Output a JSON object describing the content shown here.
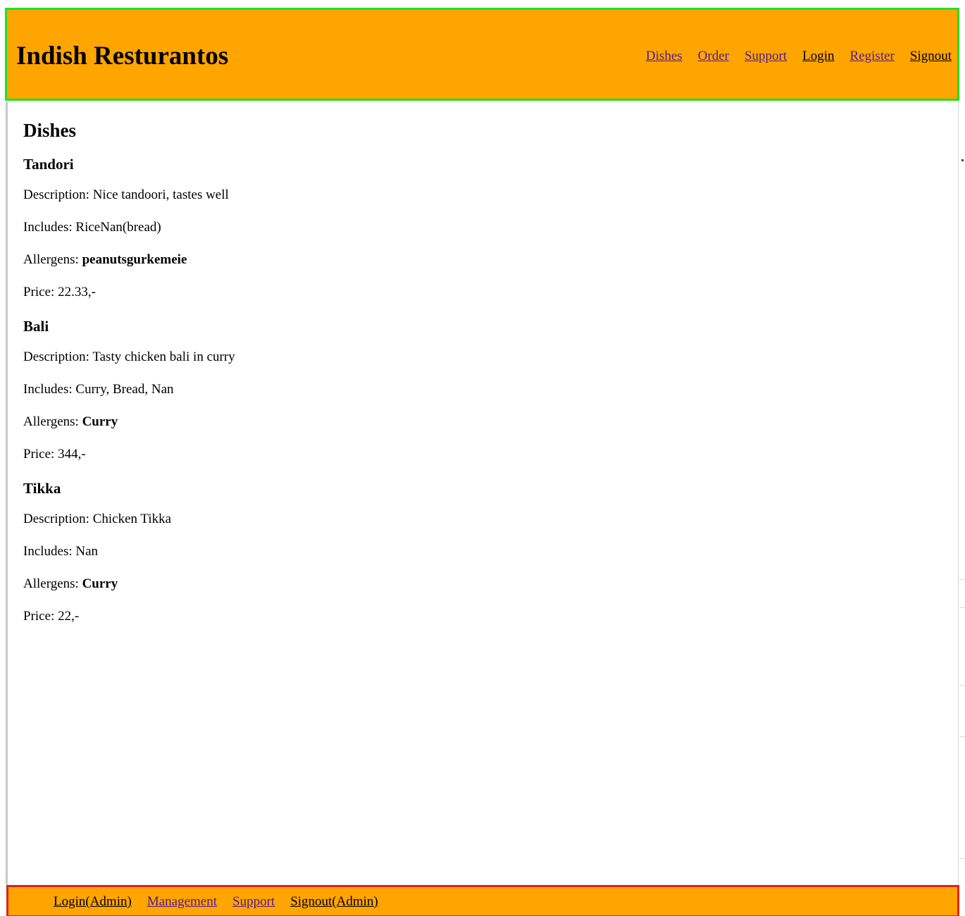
{
  "header": {
    "title": "Indish Resturantos",
    "nav": [
      {
        "label": "Dishes",
        "visited": true
      },
      {
        "label": "Order",
        "visited": true
      },
      {
        "label": "Support",
        "visited": true
      },
      {
        "label": "Login",
        "visited": false
      },
      {
        "label": "Register",
        "visited": true
      },
      {
        "label": "Signout",
        "visited": false
      }
    ]
  },
  "main": {
    "title": "Dishes",
    "dishes": [
      {
        "name": "Tandori",
        "description_label": "Description: ",
        "description": "Nice tandoori, tastes well",
        "includes_label": "Includes: ",
        "includes": "RiceNan(bread)",
        "allergens_label": "Allergens: ",
        "allergens": "peanutsgurkemeie",
        "price_label": "Price: ",
        "price": "22.33,-"
      },
      {
        "name": "Bali",
        "description_label": "Description: ",
        "description": "Tasty chicken bali in curry",
        "includes_label": "Includes: ",
        "includes": "Curry, Bread, Nan",
        "allergens_label": "Allergens: ",
        "allergens": "Curry",
        "price_label": "Price: ",
        "price": "344,-"
      },
      {
        "name": "Tikka",
        "description_label": "Description: ",
        "description": "Chicken Tikka",
        "includes_label": "Includes: ",
        "includes": "Nan",
        "allergens_label": "Allergens: ",
        "allergens": "Curry",
        "price_label": "Price: ",
        "price": "22,-"
      }
    ]
  },
  "footer": {
    "nav": [
      {
        "label": "Login(Admin)",
        "visited": false
      },
      {
        "label": "Management",
        "visited": true
      },
      {
        "label": "Support",
        "visited": true
      },
      {
        "label": "Signout(Admin)",
        "visited": false
      }
    ]
  },
  "colors": {
    "header_bg": "#ffa500",
    "header_border": "#22e022",
    "footer_border": "#e02020",
    "visited_link": "#551a8b",
    "link": "#000000"
  }
}
